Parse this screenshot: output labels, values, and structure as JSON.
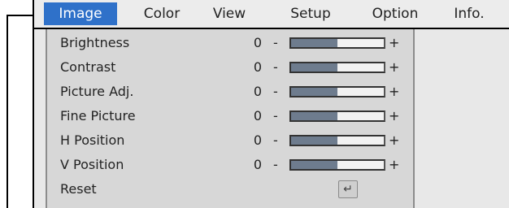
{
  "tabs": [
    {
      "label": "Image",
      "active": true
    },
    {
      "label": "Color",
      "active": false
    },
    {
      "label": "View",
      "active": false
    },
    {
      "label": "Setup",
      "active": false
    },
    {
      "label": "Option",
      "active": false
    },
    {
      "label": "Info.",
      "active": false
    }
  ],
  "settings": [
    {
      "label": "Brightness",
      "value": "0",
      "level": 0.5
    },
    {
      "label": "Contrast",
      "value": "0",
      "level": 0.5
    },
    {
      "label": "Picture Adj.",
      "value": "0",
      "level": 0.5
    },
    {
      "label": "Fine Picture",
      "value": "0",
      "level": 0.5
    },
    {
      "label": "H Position",
      "value": "0",
      "level": 0.5
    },
    {
      "label": "V Position",
      "value": "0",
      "level": 0.5
    }
  ],
  "controls": {
    "minus": "-",
    "plus": "+"
  },
  "reset": {
    "label": "Reset",
    "icon": "enter-icon",
    "glyph": "↵"
  },
  "colors": {
    "active_tab": "#2f71c9",
    "slider_fill": "#6e7c8e",
    "panel": "#d7d7d7"
  }
}
